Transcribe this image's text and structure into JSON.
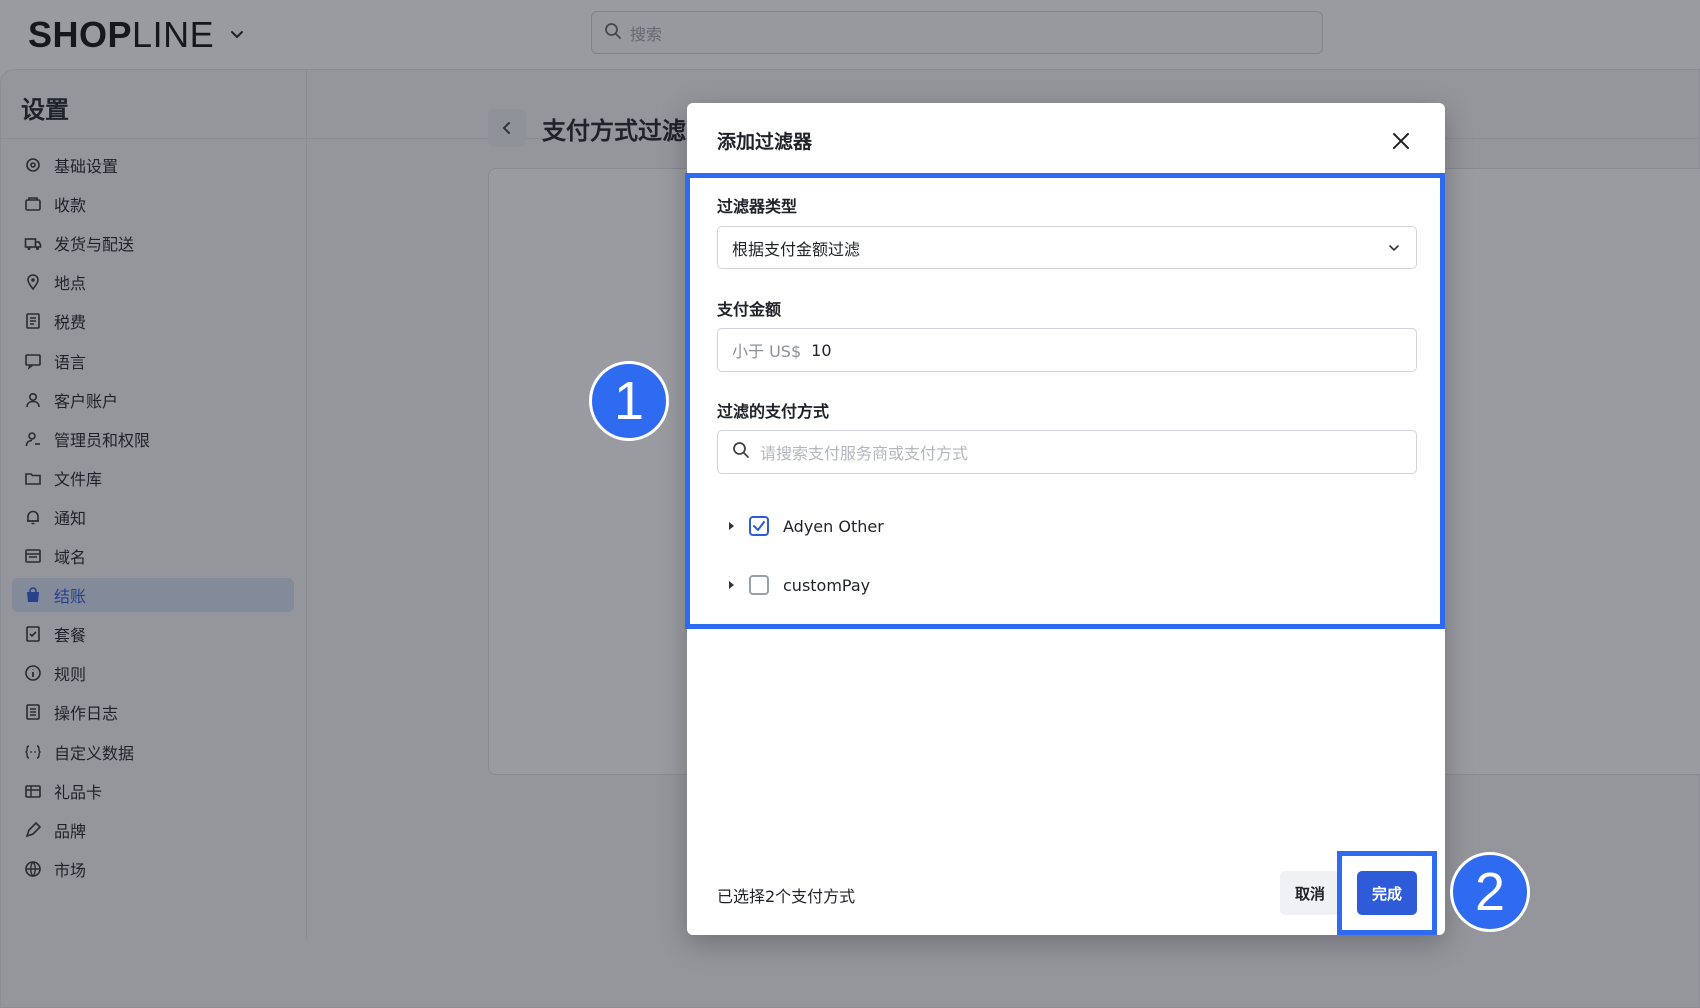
{
  "app": {
    "brand": {
      "strong": "SH",
      "o": "O",
      "p": "P",
      "light": "LINE"
    },
    "search_placeholder": "搜索"
  },
  "page": {
    "title": "设置",
    "content_title": "支付方式过滤"
  },
  "sidebar": {
    "items": [
      {
        "label": "基础设置",
        "icon": "gear-icon"
      },
      {
        "label": "收款",
        "icon": "payment-icon"
      },
      {
        "label": "发货与配送",
        "icon": "truck-icon"
      },
      {
        "label": "地点",
        "icon": "location-icon"
      },
      {
        "label": "税费",
        "icon": "tax-icon"
      },
      {
        "label": "语言",
        "icon": "language-icon"
      },
      {
        "label": "客户账户",
        "icon": "user-icon"
      },
      {
        "label": "管理员和权限",
        "icon": "admin-icon"
      },
      {
        "label": "文件库",
        "icon": "folder-icon"
      },
      {
        "label": "通知",
        "icon": "bell-icon"
      },
      {
        "label": "域名",
        "icon": "domain-icon"
      },
      {
        "label": "结账",
        "icon": "shopping-bag-icon",
        "active": true
      },
      {
        "label": "套餐",
        "icon": "plan-icon"
      },
      {
        "label": "规则",
        "icon": "info-icon"
      },
      {
        "label": "操作日志",
        "icon": "log-icon"
      },
      {
        "label": "自定义数据",
        "icon": "custom-data-icon"
      },
      {
        "label": "礼品卡",
        "icon": "gift-card-icon"
      },
      {
        "label": "品牌",
        "icon": "brand-icon"
      },
      {
        "label": "市场",
        "icon": "globe-icon"
      }
    ]
  },
  "modal": {
    "title": "添加过滤器",
    "filter_type_label": "过滤器类型",
    "filter_type_value": "根据支付金额过滤",
    "amount_label": "支付金额",
    "amount_prefix": "小于 US$",
    "amount_value": "10",
    "methods_label": "过滤的支付方式",
    "methods_search_placeholder": "请搜索支付服务商或支付方式",
    "methods": [
      {
        "label": "Adyen Other",
        "checked": true
      },
      {
        "label": "customPay",
        "checked": false
      }
    ],
    "footer_text": "已选择2个支付方式",
    "cancel_label": "取消",
    "done_label": "完成"
  },
  "annotations": {
    "step1": "1",
    "step2": "2",
    "highlight_color": "#2f6bf0"
  },
  "colors": {
    "accent": "#2e5bd8",
    "active_nav_bg": "#d6e0f5"
  }
}
